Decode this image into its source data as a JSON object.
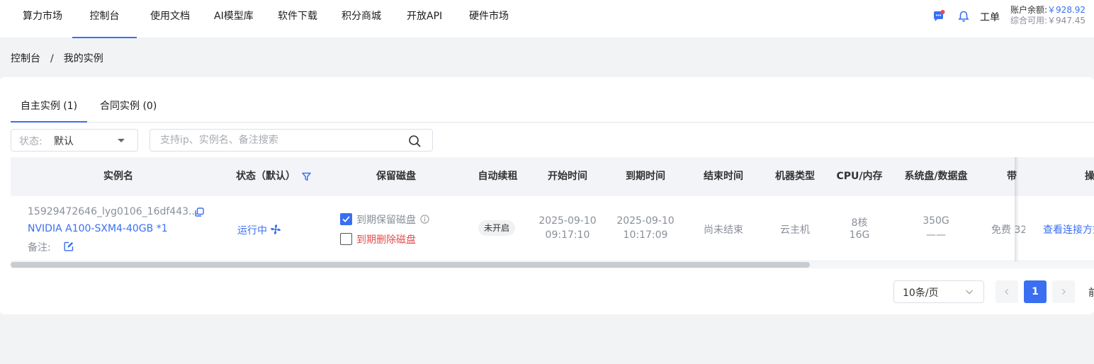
{
  "nav": {
    "items": [
      {
        "label": "算力市场"
      },
      {
        "label": "控制台"
      },
      {
        "label": "使用文档"
      },
      {
        "label": "AI模型库"
      },
      {
        "label": "软件下载"
      },
      {
        "label": "积分商城"
      },
      {
        "label": "开放API"
      },
      {
        "label": "硬件市场"
      }
    ],
    "active_index": 1,
    "ticket_label": "工单",
    "balance_label": "账户余额:",
    "balance_value": "￥928.92",
    "available_label": "综合可用:",
    "available_value": "￥947.45",
    "message_icon": "message-icon",
    "bell_icon": "bell-icon"
  },
  "breadcrumb": {
    "root": "控制台",
    "separator": "/",
    "current": "我的实例"
  },
  "tabs": [
    {
      "label": "自主实例 (1)"
    },
    {
      "label": "合同实例 (0)"
    }
  ],
  "filters": {
    "status_label": "状态:",
    "status_value": "默认",
    "search_placeholder": "支持ip、实例名、备注搜索",
    "search_value": ""
  },
  "table": {
    "columns": [
      {
        "label": "实例名"
      },
      {
        "label": "状态（默认）"
      },
      {
        "label": "保留磁盘"
      },
      {
        "label": "自动续租"
      },
      {
        "label": "开始时间"
      },
      {
        "label": "到期时间"
      },
      {
        "label": "结束时间"
      },
      {
        "label": "机器类型"
      },
      {
        "label": "CPU/内存"
      },
      {
        "label": "系统盘/数据盘"
      },
      {
        "label": "带"
      },
      {
        "label": "操"
      }
    ],
    "rows": [
      {
        "id": "15929472646_lyg0106_16df443...",
        "gpu": "NVIDIA A100-SXM4-40GB *1",
        "note_label": "备注:",
        "status": "运行中",
        "disk_keep_label": "到期保留磁盘",
        "disk_keep_checked": true,
        "disk_delete_label": "到期删除磁盘",
        "disk_delete_checked": false,
        "auto_renew": "未开启",
        "start_date": "2025-09-10",
        "start_time": "09:17:10",
        "expire_date": "2025-09-10",
        "expire_time": "10:17:09",
        "end_time": "尚未结束",
        "machine_type": "云主机",
        "cpu": "8核",
        "memory": "16G",
        "system_disk": "350G",
        "data_disk": "——",
        "bandwidth": "免费 32",
        "action": "查看连接方式"
      }
    ]
  },
  "pagination": {
    "page_size": "10条/页",
    "current_page": "1",
    "goto_label": "前"
  },
  "colors": {
    "accent": "#3a6ff2",
    "danger": "#e34d4d",
    "muted": "#8a8f99"
  }
}
